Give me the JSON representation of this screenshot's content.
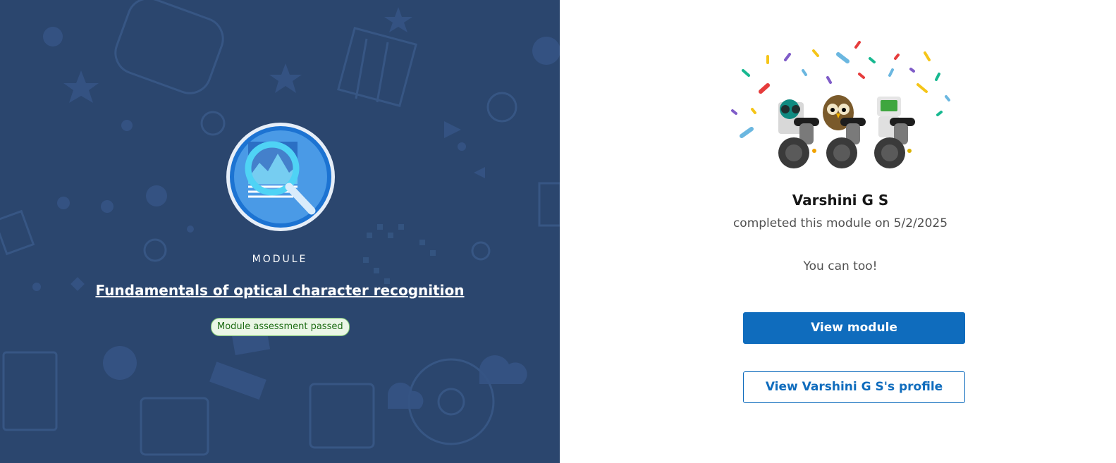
{
  "left_panel": {
    "background_color": "#2b466e",
    "badge_icon": "ocr-magnifier-badge-icon",
    "module_label": "MODULE",
    "module_title": "Fundamentals of optical character recognition",
    "status_badge": "Module assessment passed"
  },
  "right_panel": {
    "celebration_image": "celebration-robots-icon",
    "user_name": "Varshini G S",
    "completed_text": "completed this module on 5/2/2025",
    "encouragement": "You can too!",
    "primary_button": "View module",
    "secondary_button": "View Varshini G S's profile",
    "accent_color": "#0f6cbd"
  }
}
